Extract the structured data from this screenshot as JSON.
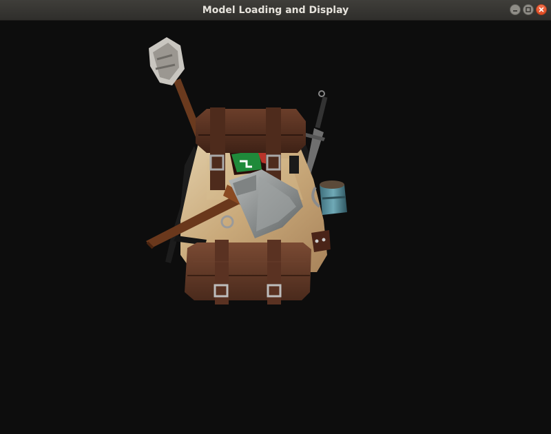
{
  "window": {
    "title": "Model Loading and Display",
    "background": "#0d0d0d",
    "titlebar_color": "#33322f",
    "close_color": "#e5562c"
  },
  "controls": {
    "minimize_icon": "minimize-icon",
    "maximize_icon": "maximize-icon",
    "close_icon": "close-icon"
  },
  "scene": {
    "model_icon": "adventurer-backpack-model",
    "objects": [
      "backpack",
      "bedroll-top",
      "bedroll-bottom",
      "axe",
      "torch",
      "sword",
      "mug",
      "shield"
    ]
  }
}
